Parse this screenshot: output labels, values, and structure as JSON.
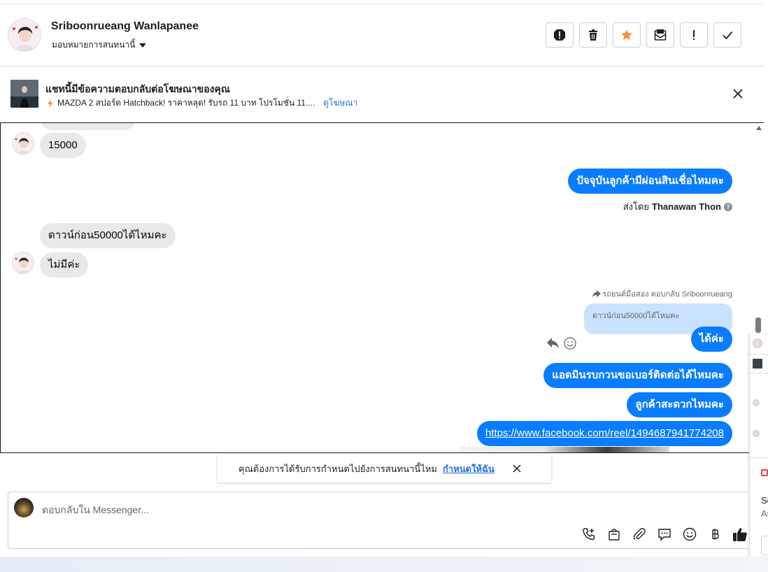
{
  "header": {
    "name": "Sriboonrueang Wanlapanee",
    "assign_label": "มอบหมายการสนทนานี้",
    "actions": [
      "spam-icon",
      "trash-icon",
      "star-icon",
      "mark-unread-icon",
      "important-icon",
      "done-icon"
    ],
    "star_color": "#f7923b"
  },
  "ad": {
    "title": "แชทนี้มีข้อความตอบกลับต่อโฆษณาของคุณ",
    "subtitle": "MAZDA 2 สปอร์ต Hatchback! ราคาหลุด! รับรถ 11 บาท โปรโมชั่น 11....",
    "link": "ดูโฆษณา"
  },
  "messages": {
    "m1": "15000",
    "m2": "ปัจจุบันลูกค้ามีผ่อนสินเชื่อไหมคะ",
    "m2_sentby_prefix": "ส่งโดย",
    "m2_sentby_name": "Thanawan Thon",
    "m3": "ดาวน์ก่อน50000ได้ไหมคะ",
    "m4": "ไม่มีค่ะ",
    "reply_header": "รถยนต์มือสอง ตอบกลับ Sriboonrueang",
    "reply_quote": "ดาวน์ก่อน50000ได้ไหมคะ",
    "m5": "ได้ค่ะ",
    "m6": "แอดมินรบกวนขอเบอร์ติดต่อได้ไหมคะ",
    "m7": "ลูกค้าสะดวกไหมคะ",
    "m8": "https://www.facebook.com/reel/1494687941774208"
  },
  "toast": {
    "text": "คุณต้องการได้รับการกำหนดไปยังการสนทนานี้ไหม",
    "link": "กำหนดให้ฉัน"
  },
  "composer": {
    "placeholder": "ตอบกลับใน Messenger...",
    "tools": [
      "call-icon",
      "shop-bag-icon",
      "attach-icon",
      "saved-reply-icon",
      "emoji-icon",
      "baht-icon",
      "thumbs-up-icon"
    ]
  },
  "side_popup": {
    "text1": "So",
    "text2": "Au"
  },
  "colors": {
    "accent": "#0a7cff",
    "link": "#216fdb",
    "incoming": "#e9e9eb",
    "quote": "#c9e2ff"
  }
}
